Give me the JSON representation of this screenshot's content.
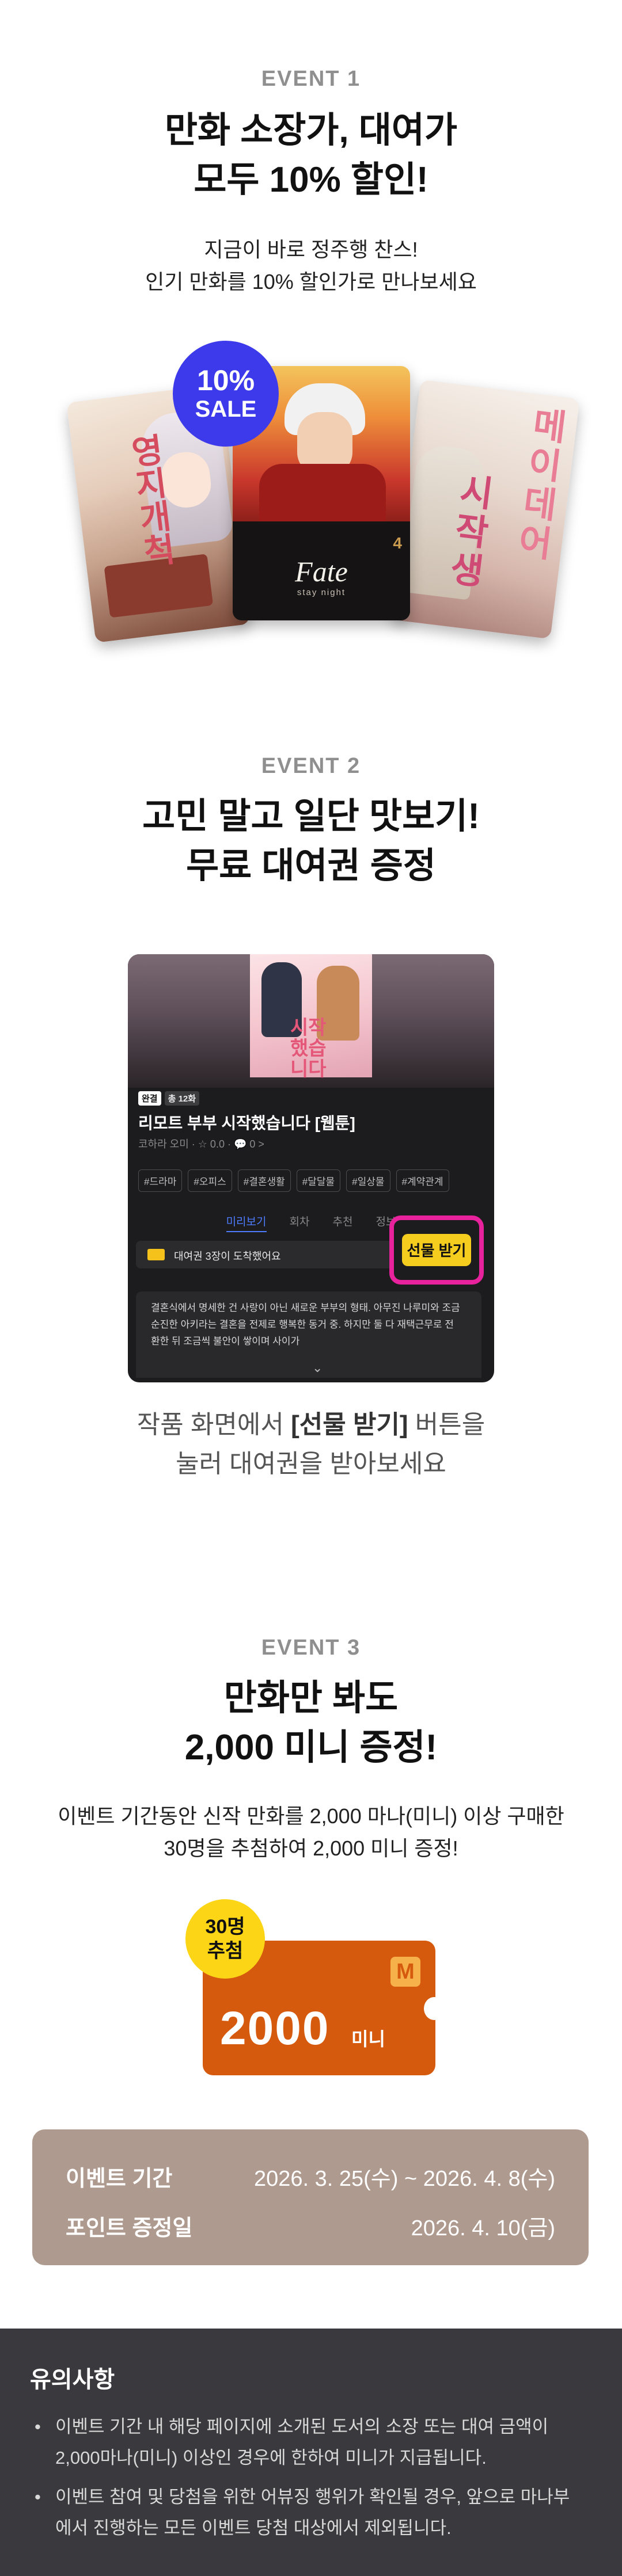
{
  "event1": {
    "label": "EVENT 1",
    "title_line1": "만화 소장가, 대여가",
    "title_line2": "모두 10% 할인!",
    "desc_line1": "지금이 바로 정주행 찬스!",
    "desc_line2": "인기 만화를 10% 할인가로 만나보세요",
    "badge_pct": "10%",
    "badge_word": "SALE",
    "books": {
      "left_title": "영지개척",
      "center_title": "Fate",
      "center_subtitle": "stay night",
      "center_volume": "4",
      "right_title_a": "메이데어",
      "right_title_b": "시작생"
    }
  },
  "event2": {
    "label": "EVENT 2",
    "title_line1": "고민 말고 일단 맛보기!",
    "title_line2": "무료 대여권 증정",
    "mock": {
      "cover_text": "시작했습니다",
      "badge_done": "완결",
      "badge_count": "총 12화",
      "title": "리모트 부부 시작했습니다 [웹툰]",
      "meta": "코하라 오미 · ☆ 0.0 · 💬 0 >",
      "tags": [
        "#드라마",
        "#오피스",
        "#결혼생활",
        "#달달물",
        "#일상물",
        "#계약관계"
      ],
      "tabs": [
        "미리보기",
        "회차",
        "추천",
        "정보"
      ],
      "notice": "대여권 3장이 도착했어요",
      "gift_button": "선물 받기",
      "desc": "결혼식에서 명세한 건 사랑이 아닌 새로운 부부의 형태. 아무진 나루미와 조금 순진한 아키라는 결혼을 전제로 행복한 동거 중. 하지만 둘 다 재택근무로 전환한 뒤 조금씩 불안이 쌓이며 사이가",
      "chevron": "⌄"
    },
    "desc_line1_pre": "작품 화면에서 ",
    "desc_line1_bold": "[선물 받기]",
    "desc_line1_post": " 버튼을",
    "desc_line2": "눌러 대여권을 받아보세요"
  },
  "event3": {
    "label": "EVENT 3",
    "title_line1": "만화만 봐도",
    "title_line2": "2,000 미니 증정!",
    "desc_line1": "이벤트 기간동안 신작 만화를 2,000 마나(미니) 이상 구매한",
    "desc_line2": "30명을 추첨하여 2,000 미니 증정!",
    "coupon_badge_line1": "30명",
    "coupon_badge_line2": "추첨",
    "coupon_amount": "2000",
    "coupon_unit": "미니",
    "coupon_logo": "M"
  },
  "info": {
    "period_label": "이벤트 기간",
    "period_value": "2026. 3. 25(수) ~ 2026. 4. 8(수)",
    "point_label": "포인트 증정일",
    "point_value": "2026. 4. 10(금)"
  },
  "notice": {
    "title": "유의사항",
    "items": [
      "이벤트 기간 내 해당 페이지에 소개된 도서의 소장 또는 대여 금액이 2,000마나(미니) 이상인 경우에 한하여 미니가 지급됩니다.",
      "이벤트 참여 및 당첨을 위한 어뷰징 행위가 확인될 경우, 앞으로 마나부에서 진행하는 모든 이벤트 당첨 대상에서 제외됩니다."
    ]
  },
  "colors": {
    "sale_badge": "#3c3aeb",
    "gift_button": "#f4cd1e",
    "gift_highlight": "#e8229d",
    "coupon": "#d65a0e",
    "coupon_badge": "#fcd516",
    "info_box": "#ae9a8f",
    "footer_bg": "#3a3a3e"
  }
}
